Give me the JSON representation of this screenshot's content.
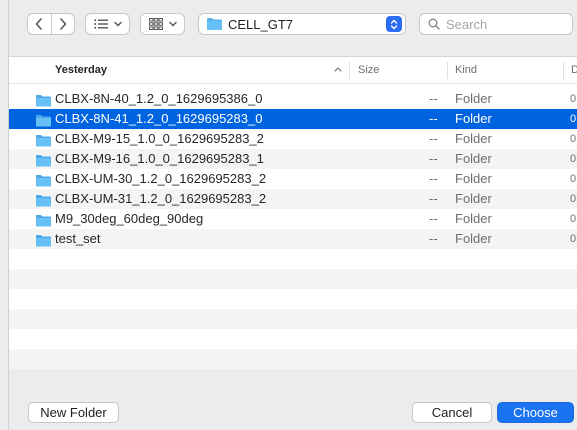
{
  "toolbar": {
    "back_icon": "chevron-left-icon",
    "forward_icon": "chevron-right-icon",
    "list_view_icon": "list-icon",
    "grid_view_icon": "grid-icon",
    "path": "CELL_GT7",
    "search_placeholder": "Search"
  },
  "columns": {
    "name": "Yesterday",
    "size": "Size",
    "kind": "Kind",
    "date": "D"
  },
  "files": [
    {
      "name": "CLBX-8N-40_1.2_0_1629695386_0",
      "size": "--",
      "kind": "Folder",
      "date": "0",
      "selected": false
    },
    {
      "name": "CLBX-8N-41_1.2_0_1629695283_0",
      "size": "--",
      "kind": "Folder",
      "date": "0",
      "selected": true
    },
    {
      "name": "CLBX-M9-15_1.0_0_1629695283_2",
      "size": "--",
      "kind": "Folder",
      "date": "0",
      "selected": false
    },
    {
      "name": "CLBX-M9-16_1.0_0_1629695283_1",
      "size": "--",
      "kind": "Folder",
      "date": "0",
      "selected": false
    },
    {
      "name": "CLBX-UM-30_1.2_0_1629695283_2",
      "size": "--",
      "kind": "Folder",
      "date": "0",
      "selected": false
    },
    {
      "name": "CLBX-UM-31_1.2_0_1629695283_2",
      "size": "--",
      "kind": "Folder",
      "date": "0",
      "selected": false
    },
    {
      "name": "M9_30deg_60deg_90deg",
      "size": "--",
      "kind": "Folder",
      "date": "0",
      "selected": false
    },
    {
      "name": "test_set",
      "size": "--",
      "kind": "Folder",
      "date": "0",
      "selected": false
    }
  ],
  "buttons": {
    "new_folder": "New Folder",
    "cancel": "Cancel",
    "choose": "Choose"
  },
  "colors": {
    "accent": "#0064e1",
    "folder": "#5ab4f0",
    "primary_button": "#1a73f0"
  }
}
